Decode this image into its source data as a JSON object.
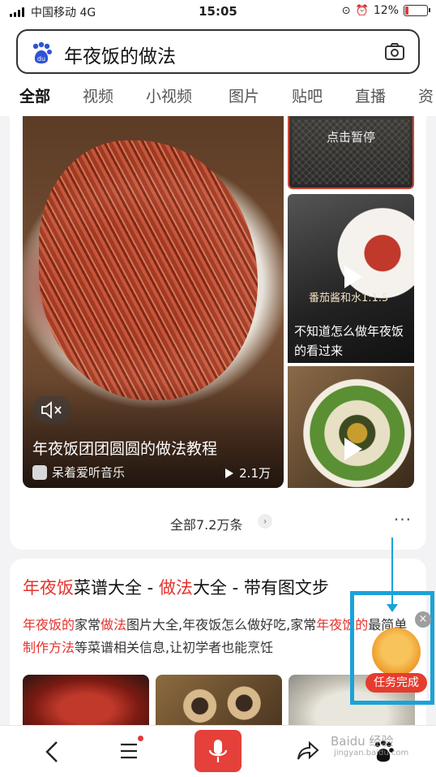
{
  "status_bar": {
    "carrier": "中国移动",
    "network": "4G",
    "time": "15:05",
    "battery": "12%",
    "battery_level": 0.12,
    "battery_color": "#e53935"
  },
  "search": {
    "query": "年夜饭的做法",
    "logo_icon": "baidu-paw-icon",
    "camera_icon": "camera-icon"
  },
  "tabs": [
    {
      "label": "全部",
      "active": true
    },
    {
      "label": "视频"
    },
    {
      "label": "小视频"
    },
    {
      "label": "图片"
    },
    {
      "label": "贴吧"
    },
    {
      "label": "直播"
    },
    {
      "label": "资"
    }
  ],
  "accent_color": "#3478f6",
  "video_card": {
    "main_video": {
      "title": "年夜饭团团圆圆的做法教程",
      "source": "呆着爱听音乐",
      "plays": "2.1万",
      "mute_icon": "mute-icon"
    },
    "thumbs": [
      {
        "caption": "点击暂停"
      },
      {
        "overlay": "番茄酱和水1:1.5",
        "title": "不知道怎么做年夜饭的看过来",
        "play_icon": "play-icon"
      },
      {
        "play_icon": "play-icon"
      }
    ],
    "total": "全部7.2万条",
    "more": "···"
  },
  "recipe_card": {
    "title": {
      "hl1": "年夜饭",
      "t1": "菜谱大全 - ",
      "hl2": "做法",
      "t2": "大全 - 带有图文步"
    },
    "body": {
      "hl1": "年夜饭的",
      "t1": "家常",
      "hl2": "做法",
      "t2": "图片大全,年夜饭怎么做好吃,家常",
      "hl3": "年夜饭的",
      "t3": "最简单",
      "hl4": "制作方法",
      "t4": "等菜谱相关信息,让初学者也能烹饪"
    }
  },
  "task_widget": {
    "label": "任务完成",
    "close": "×",
    "frame_color": "#1aa3d8"
  },
  "bottom_bar": {
    "icons": [
      "back-icon",
      "menu-icon",
      "mic-icon",
      "share-icon",
      "baidu-paw-icon"
    ],
    "mic_color": "#e5403a"
  },
  "watermark": {
    "line1": "Baidu 经验",
    "line2": "jingyan.baidu.com"
  }
}
